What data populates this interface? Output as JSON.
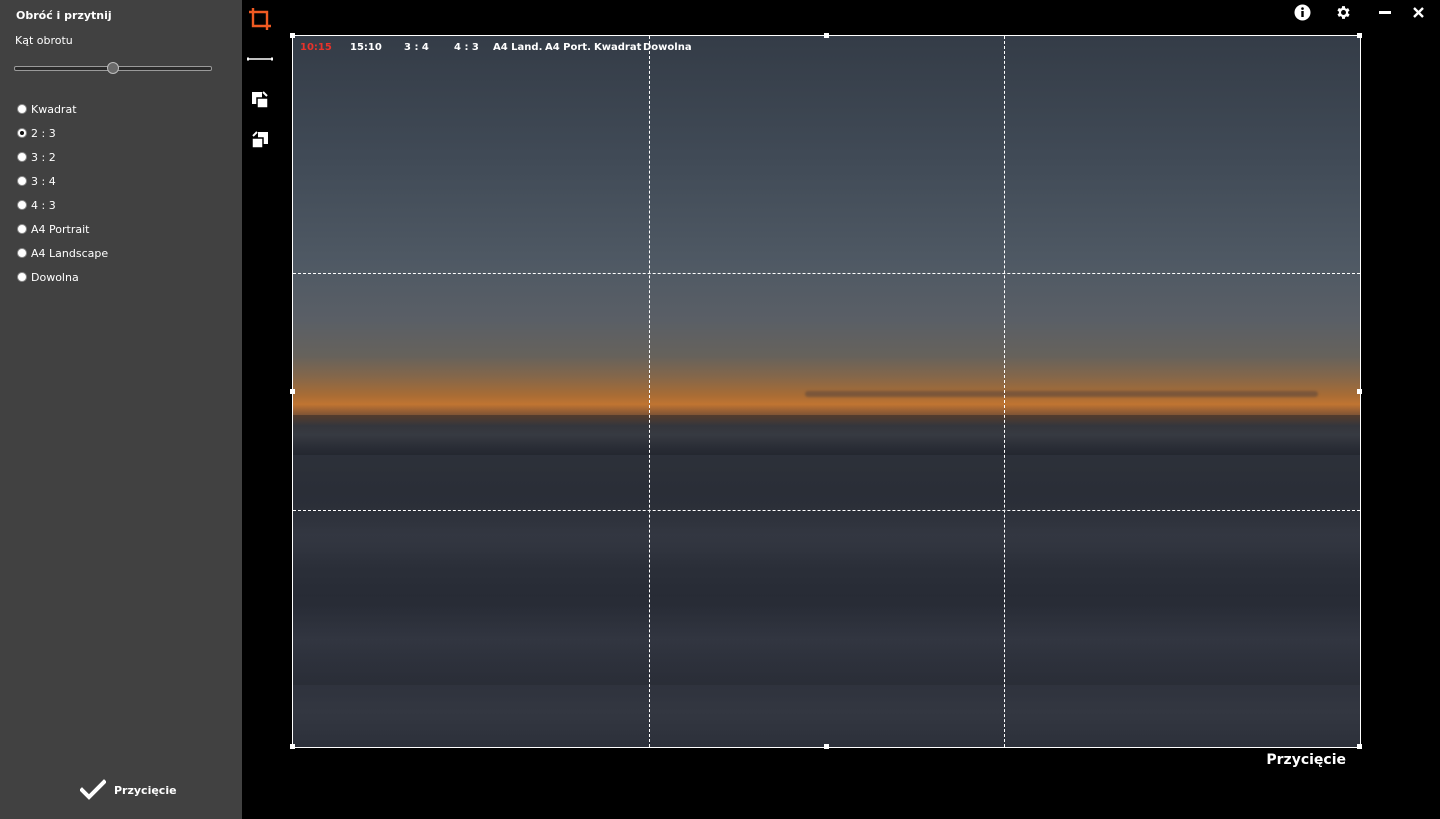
{
  "panel": {
    "title": "Obróć i przytnij",
    "angle_label": "Kąt obrotu",
    "angle_slider_value": 0.5,
    "ratios": [
      {
        "label": "Kwadrat",
        "checked": false
      },
      {
        "label": "2 : 3",
        "checked": true
      },
      {
        "label": "3 : 2",
        "checked": false
      },
      {
        "label": "3 : 4",
        "checked": false
      },
      {
        "label": "4 : 3",
        "checked": false
      },
      {
        "label": "A4 Portrait",
        "checked": false
      },
      {
        "label": "A4 Landscape",
        "checked": false
      },
      {
        "label": "Dowolna",
        "checked": false
      }
    ],
    "apply_label": "Przycięcie"
  },
  "tools": {
    "crop_icon": "crop-icon",
    "straighten_icon": "straighten-line-icon",
    "rotate_left_icon": "rotate-left-icon",
    "rotate_right_icon": "rotate-right-icon",
    "accent_color": "#f05a22"
  },
  "window": {
    "info_icon": "info-icon",
    "settings_icon": "gear-icon",
    "minimize_icon": "minimize-icon",
    "close_icon": "close-icon"
  },
  "ratio_bar": {
    "items": [
      {
        "label": "10:15",
        "active": true
      },
      {
        "label": "15:10",
        "active": false
      },
      {
        "label": "3 : 4",
        "active": false
      },
      {
        "label": "4 : 3",
        "active": false
      },
      {
        "label": "A4 Land.",
        "active": false
      },
      {
        "label": "A4 Port.",
        "active": false
      },
      {
        "label": "Kwadrat",
        "active": false
      },
      {
        "label": "Dowolna",
        "active": false
      }
    ],
    "active_color": "#e8322a"
  },
  "canvas": {
    "crop_label": "Przycięcie"
  }
}
